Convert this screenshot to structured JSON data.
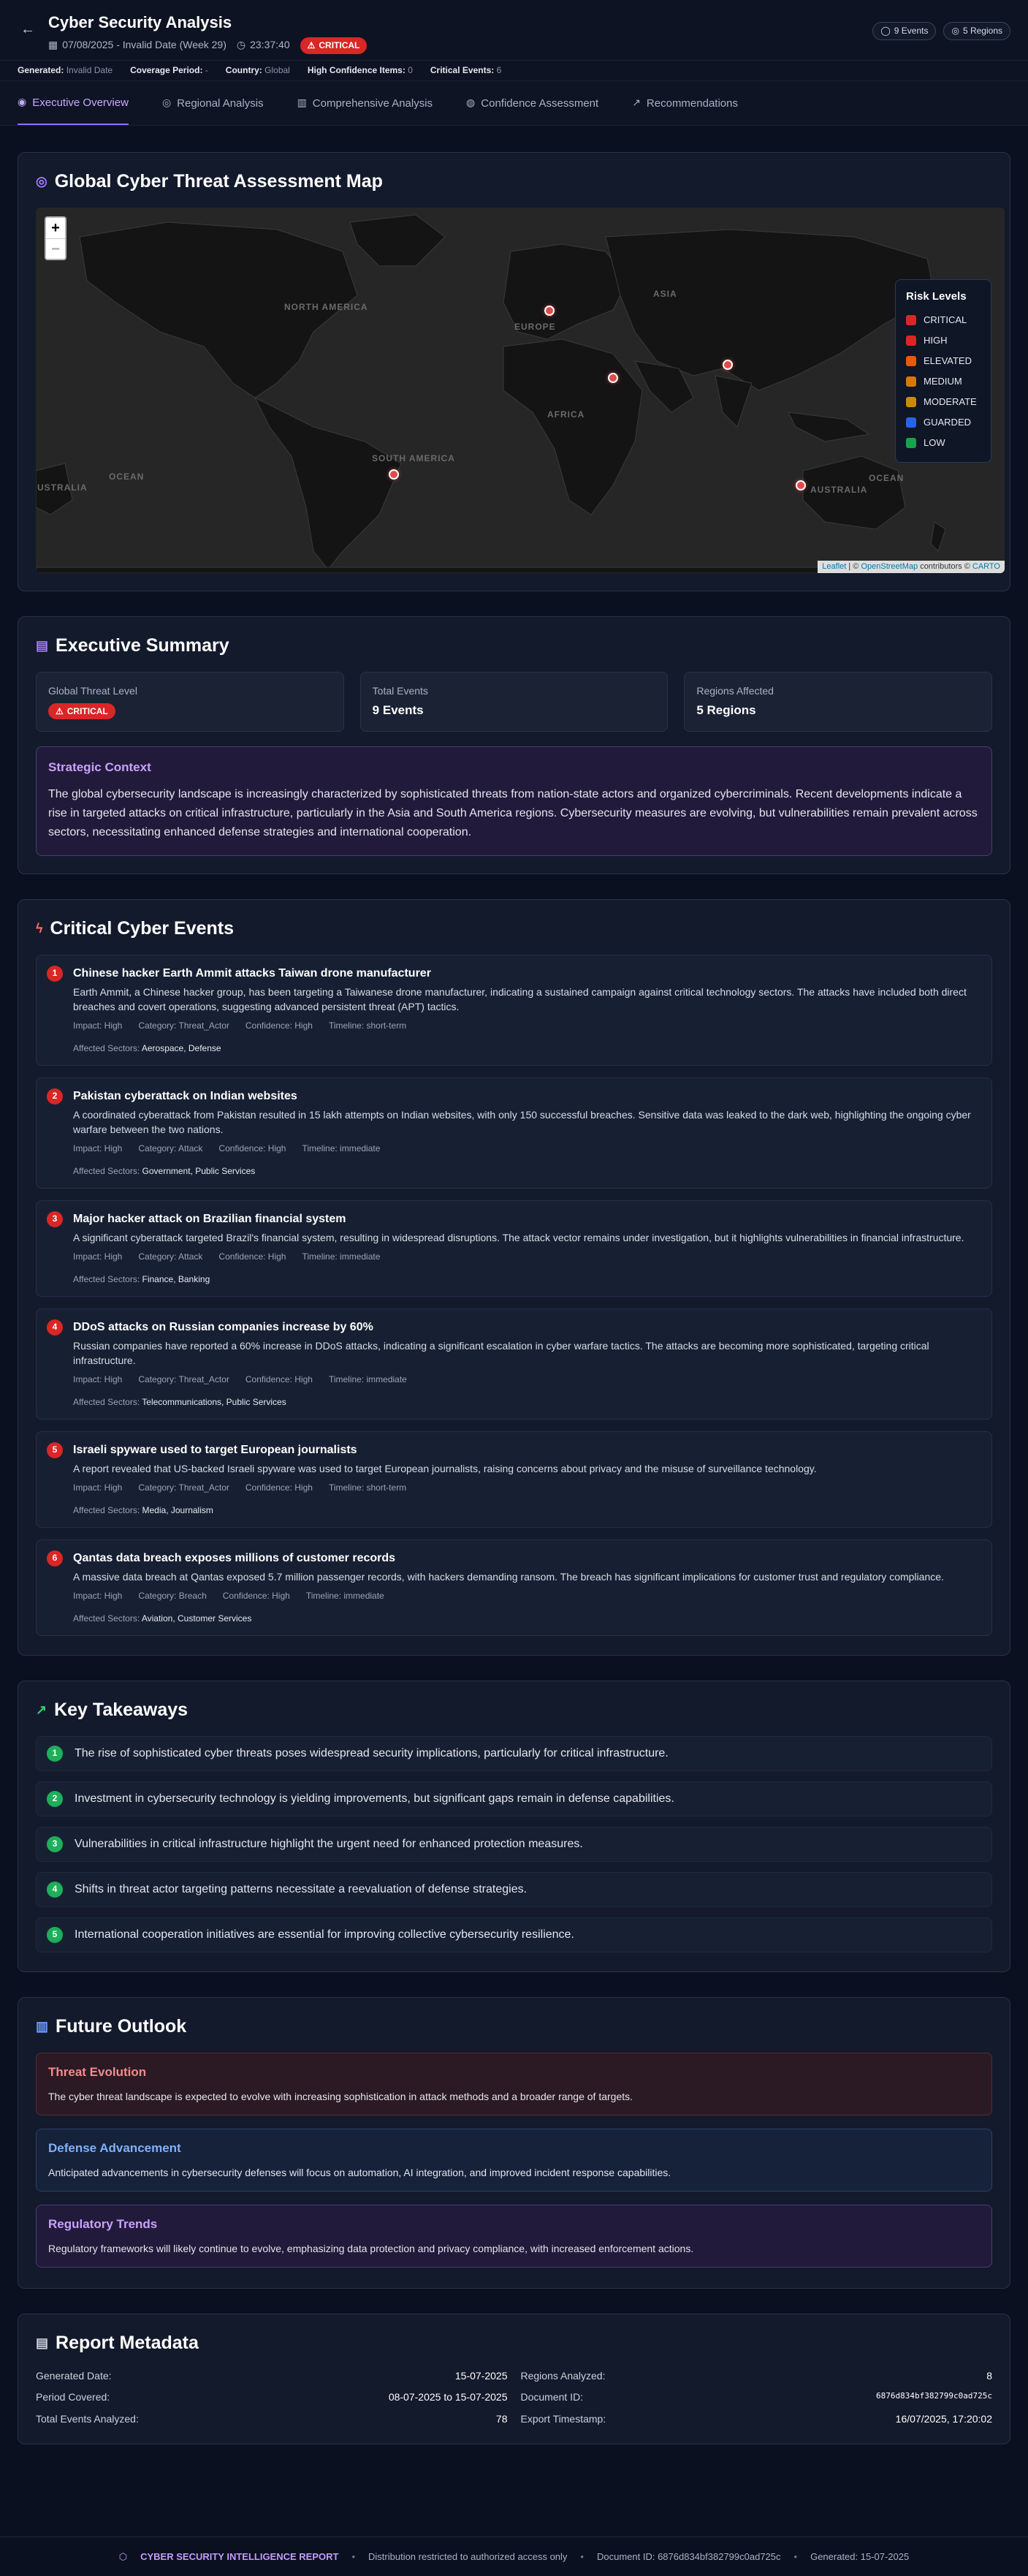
{
  "header": {
    "title": "Cyber Security Analysis",
    "date_text": "07/08/2025 - Invalid Date (Week 29)",
    "time_text": "23:37:40",
    "badge": "CRITICAL",
    "events_pill": "9 Events",
    "regions_pill": "5 Regions"
  },
  "metabar": {
    "generated_label": "Generated:",
    "generated_value": "Invalid Date",
    "coverage_label": "Coverage Period:",
    "coverage_value": "-",
    "country_label": "Country:",
    "country_value": "Global",
    "high_conf_label": "High Confidence Items:",
    "high_conf_value": "0",
    "critical_label": "Critical Events:",
    "critical_value": "6"
  },
  "tabs": [
    {
      "label": "Executive Overview",
      "icon": "eye-icon"
    },
    {
      "label": "Regional Analysis",
      "icon": "globe-icon"
    },
    {
      "label": "Comprehensive Analysis",
      "icon": "bar-chart-icon"
    },
    {
      "label": "Confidence Assessment",
      "icon": "target-icon"
    },
    {
      "label": "Recommendations",
      "icon": "trend-icon"
    }
  ],
  "map": {
    "title": "Global Cyber Threat Assessment Map",
    "zoom_in": "+",
    "zoom_out": "−",
    "labels": [
      "NORTH AMERICA",
      "EUROPE",
      "ASIA",
      "AFRICA",
      "SOUTH AMERICA",
      "AUSTRALIA",
      "OCEAN",
      "OCEAN",
      "USTRALIA"
    ],
    "legend_title": "Risk Levels",
    "legend": [
      {
        "label": "CRITICAL",
        "color": "#dc2626"
      },
      {
        "label": "HIGH",
        "color": "#dc2626"
      },
      {
        "label": "ELEVATED",
        "color": "#ea580c"
      },
      {
        "label": "MEDIUM",
        "color": "#d97706"
      },
      {
        "label": "MODERATE",
        "color": "#ca8a04"
      },
      {
        "label": "GUARDED",
        "color": "#2563eb"
      },
      {
        "label": "LOW",
        "color": "#16a34a"
      }
    ],
    "attribution_leaflet": "Leaflet",
    "attribution_sep": "| ©",
    "attribution_osm": "OpenStreetMap",
    "attribution_mid": "contributors ©",
    "attribution_carto": "CARTO"
  },
  "summary": {
    "title": "Executive Summary",
    "threat_label": "Global Threat Level",
    "threat_value": "CRITICAL",
    "events_label": "Total Events",
    "events_value": "9 Events",
    "regions_label": "Regions Affected",
    "regions_value": "5 Regions",
    "context_title": "Strategic Context",
    "context_text": "The global cybersecurity landscape is increasingly characterized by sophisticated threats from nation-state actors and organized cybercriminals. Recent developments indicate a rise in targeted attacks on critical infrastructure, particularly in the Asia and South America regions. Cybersecurity measures are evolving, but vulnerabilities remain prevalent across sectors, necessitating enhanced defense strategies and international cooperation."
  },
  "events": {
    "title": "Critical Cyber Events",
    "items": [
      {
        "num": "1",
        "title": "Chinese hacker Earth Ammit attacks Taiwan drone manufacturer",
        "desc": "Earth Ammit, a Chinese hacker group, has been targeting a Taiwanese drone manufacturer, indicating a sustained campaign against critical technology sectors. The attacks have included both direct breaches and covert operations, suggesting advanced persistent threat (APT) tactics.",
        "impact": "Impact: High",
        "category": "Category: Threat_Actor",
        "confidence": "Confidence: High",
        "timeline": "Timeline: short-term",
        "sectors_label": "Affected Sectors:",
        "sectors": "Aerospace, Defense"
      },
      {
        "num": "2",
        "title": "Pakistan cyberattack on Indian websites",
        "desc": "A coordinated cyberattack from Pakistan resulted in 15 lakh attempts on Indian websites, with only 150 successful breaches. Sensitive data was leaked to the dark web, highlighting the ongoing cyber warfare between the two nations.",
        "impact": "Impact: High",
        "category": "Category: Attack",
        "confidence": "Confidence: High",
        "timeline": "Timeline: immediate",
        "sectors_label": "Affected Sectors:",
        "sectors": "Government, Public Services"
      },
      {
        "num": "3",
        "title": "Major hacker attack on Brazilian financial system",
        "desc": "A significant cyberattack targeted Brazil's financial system, resulting in widespread disruptions. The attack vector remains under investigation, but it highlights vulnerabilities in financial infrastructure.",
        "impact": "Impact: High",
        "category": "Category: Attack",
        "confidence": "Confidence: High",
        "timeline": "Timeline: immediate",
        "sectors_label": "Affected Sectors:",
        "sectors": "Finance, Banking"
      },
      {
        "num": "4",
        "title": "DDoS attacks on Russian companies increase by 60%",
        "desc": "Russian companies have reported a 60% increase in DDoS attacks, indicating a significant escalation in cyber warfare tactics. The attacks are becoming more sophisticated, targeting critical infrastructure.",
        "impact": "Impact: High",
        "category": "Category: Threat_Actor",
        "confidence": "Confidence: High",
        "timeline": "Timeline: immediate",
        "sectors_label": "Affected Sectors:",
        "sectors": "Telecommunications, Public Services"
      },
      {
        "num": "5",
        "title": "Israeli spyware used to target European journalists",
        "desc": "A report revealed that US-backed Israeli spyware was used to target European journalists, raising concerns about privacy and the misuse of surveillance technology.",
        "impact": "Impact: High",
        "category": "Category: Threat_Actor",
        "confidence": "Confidence: High",
        "timeline": "Timeline: short-term",
        "sectors_label": "Affected Sectors:",
        "sectors": "Media, Journalism"
      },
      {
        "num": "6",
        "title": "Qantas data breach exposes millions of customer records",
        "desc": "A massive data breach at Qantas exposed 5.7 million passenger records, with hackers demanding ransom. The breach has significant implications for customer trust and regulatory compliance.",
        "impact": "Impact: High",
        "category": "Category: Breach",
        "confidence": "Confidence: High",
        "timeline": "Timeline: immediate",
        "sectors_label": "Affected Sectors:",
        "sectors": "Aviation, Customer Services"
      }
    ]
  },
  "takeaways": {
    "title": "Key Takeaways",
    "items": [
      {
        "num": "1",
        "text": "The rise of sophisticated cyber threats poses widespread security implications, particularly for critical infrastructure."
      },
      {
        "num": "2",
        "text": "Investment in cybersecurity technology is yielding improvements, but significant gaps remain in defense capabilities."
      },
      {
        "num": "3",
        "text": "Vulnerabilities in critical infrastructure highlight the urgent need for enhanced protection measures."
      },
      {
        "num": "4",
        "text": "Shifts in threat actor targeting patterns necessitate a reevaluation of defense strategies."
      },
      {
        "num": "5",
        "text": "International cooperation initiatives are essential for improving collective cybersecurity resilience."
      }
    ]
  },
  "outlook": {
    "title": "Future Outlook",
    "items": [
      {
        "title": "Threat Evolution",
        "text": "The cyber threat landscape is expected to evolve with increasing sophistication in attack methods and a broader range of targets."
      },
      {
        "title": "Defense Advancement",
        "text": "Anticipated advancements in cybersecurity defenses will focus on automation, AI integration, and improved incident response capabilities."
      },
      {
        "title": "Regulatory Trends",
        "text": "Regulatory frameworks will likely continue to evolve, emphasizing data protection and privacy compliance, with increased enforcement actions."
      }
    ]
  },
  "metadata": {
    "title": "Report Metadata",
    "rows": [
      {
        "k": "Generated Date:",
        "v": "15-07-2025"
      },
      {
        "k": "Regions Analyzed:",
        "v": "8"
      },
      {
        "k": "Period Covered:",
        "v": "08-07-2025 to 15-07-2025"
      },
      {
        "k": "Document ID:",
        "v": "6876d834bf382799c0ad725c"
      },
      {
        "k": "Total Events Analyzed:",
        "v": "78"
      },
      {
        "k": "Export Timestamp:",
        "v": "16/07/2025, 17:20:02"
      }
    ]
  },
  "footer": {
    "brand": "CYBER SECURITY INTELLIGENCE REPORT",
    "restricted": "Distribution restricted to authorized access only",
    "docid": "Document ID: 6876d834bf382799c0ad725c",
    "generated": "Generated: 15-07-2025"
  }
}
